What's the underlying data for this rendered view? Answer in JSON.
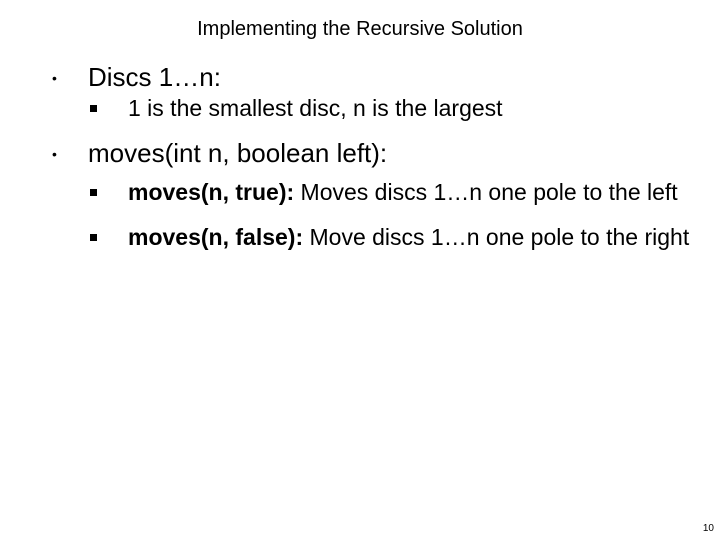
{
  "slide": {
    "title": "Implementing the Recursive Solution",
    "b1": "Discs 1…n:",
    "b1_1": "1 is the smallest disc, n is the largest",
    "b2": "moves(int n, boolean left):",
    "b2_1_bold": "moves(n, true):",
    "b2_1_rest": " Moves discs 1…n one pole to the left",
    "b2_2_bold": "moves(n, false):",
    "b2_2_rest": " Move discs 1…n one pole to the right",
    "page_number": "10"
  }
}
